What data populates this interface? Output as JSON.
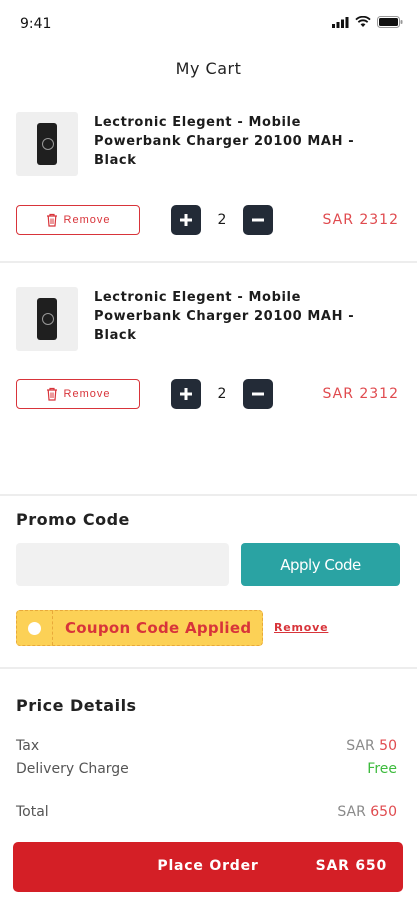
{
  "status_bar": {
    "time": "9:41"
  },
  "header": {
    "title": "My Cart"
  },
  "cart": {
    "items": [
      {
        "title": "Lectronic Elegent - Mobile Powerbank Charger 20100 MAH - Black",
        "remove_label": "Remove",
        "quantity": "2",
        "price": "SAR 2312"
      },
      {
        "title": "Lectronic Elegent - Mobile Powerbank Charger 20100 MAH - Black",
        "remove_label": "Remove",
        "quantity": "2",
        "price": "SAR 2312"
      }
    ]
  },
  "promo": {
    "title": "Promo Code",
    "input_value": "",
    "apply_label": "Apply Code",
    "coupon_applied": "Coupon Code Applied",
    "coupon_remove": "Remove"
  },
  "price_details": {
    "title": "Price Details",
    "tax_label": "Tax",
    "tax_currency": "SAR",
    "tax_amount": "50",
    "delivery_label": "Delivery Charge",
    "delivery_value": "Free",
    "total_label": "Total",
    "total_currency": "SAR",
    "total_amount": "650"
  },
  "footer": {
    "place_order_label": "Place Order",
    "place_order_total": "SAR 650"
  },
  "colors": {
    "accent_red": "#d41f26",
    "teal": "#2aa3a3",
    "coupon_yellow": "#fcd156",
    "dark_button": "#232b37"
  }
}
